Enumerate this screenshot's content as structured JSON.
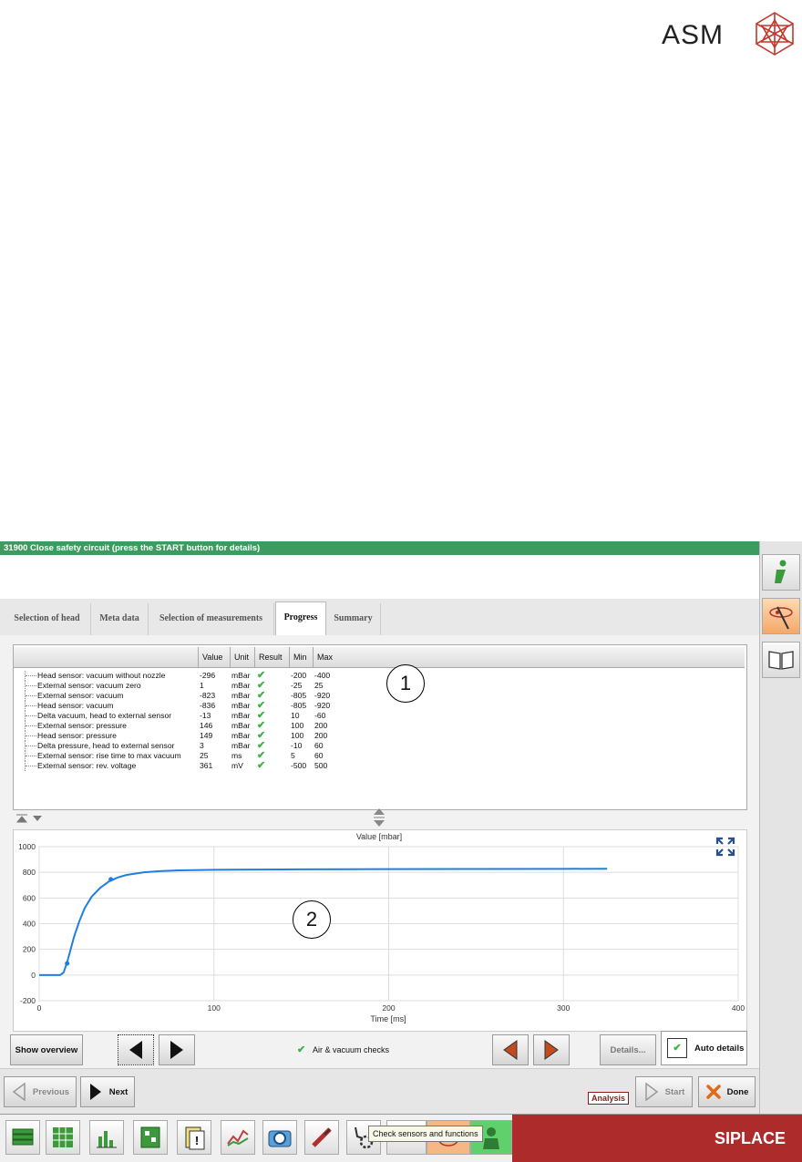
{
  "logo": {
    "text": "ASM"
  },
  "window": {
    "title": "31900 Close safety circuit (press the START button for details)"
  },
  "tabs": [
    {
      "label": "Selection of head"
    },
    {
      "label": "Meta data"
    },
    {
      "label": "Selection of measurements"
    },
    {
      "label": "Progress"
    },
    {
      "label": "Summary"
    }
  ],
  "active_tab": "Progress",
  "table": {
    "columns": [
      "Value",
      "Unit",
      "Result",
      "Min",
      "Max"
    ],
    "rows": [
      {
        "name": "Head sensor: vacuum without nozzle",
        "value": "-296",
        "unit": "mBar",
        "min": "-200",
        "max": "-400"
      },
      {
        "name": "External sensor: vacuum zero",
        "value": "1",
        "unit": "mBar",
        "min": "-25",
        "max": "25"
      },
      {
        "name": "External sensor: vacuum",
        "value": "-823",
        "unit": "mBar",
        "min": "-805",
        "max": "-920"
      },
      {
        "name": "Head sensor: vacuum",
        "value": "-836",
        "unit": "mBar",
        "min": "-805",
        "max": "-920"
      },
      {
        "name": "Delta vacuum, head to external sensor",
        "value": "-13",
        "unit": "mBar",
        "min": "10",
        "max": "-60"
      },
      {
        "name": "External sensor: pressure",
        "value": "146",
        "unit": "mBar",
        "min": "100",
        "max": "200"
      },
      {
        "name": "Head sensor: pressure",
        "value": "149",
        "unit": "mBar",
        "min": "100",
        "max": "200"
      },
      {
        "name": "Delta pressure, head to external sensor",
        "value": "3",
        "unit": "mBar",
        "min": "-10",
        "max": "60"
      },
      {
        "name": "External sensor: rise time to max vacuum",
        "value": "25",
        "unit": "ms",
        "min": "5",
        "max": "60"
      },
      {
        "name": "External sensor: rev. voltage",
        "value": "361",
        "unit": "mV",
        "min": "-500",
        "max": "500"
      }
    ]
  },
  "callouts": {
    "one": "1",
    "two": "2"
  },
  "chart_data": {
    "type": "line",
    "title": "Value [mbar]",
    "xlabel": "Time [ms]",
    "ylabel": "",
    "xlim": [
      0,
      400
    ],
    "ylim": [
      -200,
      1000
    ],
    "x_ticks": [
      0,
      100,
      200,
      300,
      400
    ],
    "y_ticks": [
      -200,
      0,
      200,
      400,
      600,
      800,
      1000
    ],
    "grid": true,
    "series": [
      {
        "color": "#1f7fe0",
        "x": [
          0,
          12,
          14,
          16,
          18,
          20,
          23,
          26,
          30,
          35,
          40,
          45,
          50,
          60,
          70,
          80,
          100,
          125,
          150,
          200,
          250,
          300,
          325
        ],
        "y": [
          0,
          0,
          20,
          100,
          200,
          300,
          420,
          520,
          610,
          680,
          730,
          760,
          780,
          800,
          810,
          815,
          820,
          822,
          823,
          825,
          826,
          827,
          828
        ]
      }
    ],
    "markers": [
      {
        "x": 16,
        "y": 90
      },
      {
        "x": 41,
        "y": 745
      }
    ]
  },
  "buttons": {
    "show_overview": "Show overview",
    "check_label": "Air & vacuum checks",
    "details": "Details...",
    "auto_details": "Auto details",
    "previous": "Previous",
    "next": "Next",
    "analysis": "Analysis",
    "start": "Start",
    "done": "Done"
  },
  "taskbar": {
    "tooltip": "Check sensors and functions",
    "brand": "SIPLACE"
  },
  "colors": {
    "title_green": "#3d9b5f",
    "brand_red": "#ad2b2b",
    "line_blue": "#1f7fe0",
    "check_green": "#3cb043"
  }
}
